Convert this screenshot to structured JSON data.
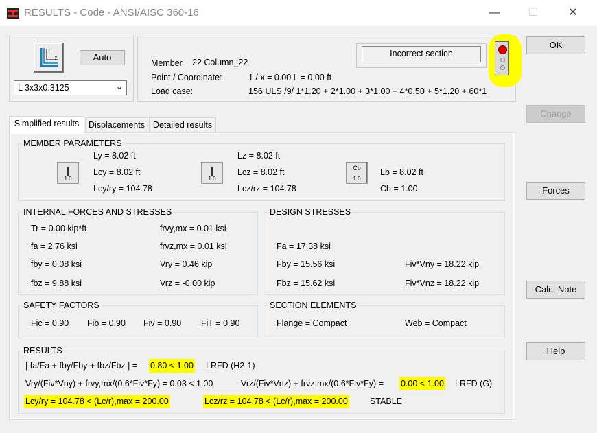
{
  "window": {
    "title": "RESULTS - Code - ANSI/AISC 360-16",
    "minimize": "—",
    "maximize": "☐",
    "close": "✕"
  },
  "section": {
    "auto_label": "Auto",
    "selected": "L 3x3x0.3125"
  },
  "info": {
    "status": "Incorrect section",
    "member_label": "Member",
    "member_value": "22  Column_22",
    "point_label": "Point / Coordinate:",
    "point_value": "1 / x = 0.00 L = 0.00 ft",
    "load_label": "Load case:",
    "load_value": "156 ULS /9/  1*1.20 + 2*1.00 + 3*1.00 + 4*0.50 + 5*1.20 + 60*1"
  },
  "buttons": {
    "ok": "OK",
    "change": "Change",
    "forces": "Forces",
    "calc_note": "Calc. Note",
    "help": "Help"
  },
  "tabs": [
    "Simplified results",
    "Displacements",
    "Detailed results"
  ],
  "member_params": {
    "title": "MEMBER PARAMETERS",
    "icon_label": "1.0",
    "cb_icon": "Cb",
    "ly": "Ly = 8.02 ft",
    "lcy": "Lcy = 8.02 ft",
    "lcy_ry": "Lcy/ry = 104.78",
    "lz": "Lz = 8.02 ft",
    "lcz": "Lcz = 8.02 ft",
    "lcz_rz": "Lcz/rz = 104.78",
    "lb": "Lb = 8.02 ft",
    "cb": "Cb = 1.00"
  },
  "internal": {
    "title": "INTERNAL FORCES AND STRESSES",
    "tr": "Tr = 0.00 kip*ft",
    "fa": "fa = 2.76 ksi",
    "fby": "fby = 0.08 ksi",
    "fbz": "fbz = 9.88 ksi",
    "frvy": "frvy,mx = 0.01 ksi",
    "frvz": "frvz,mx = 0.01 ksi",
    "vry": "Vry = 0.46 kip",
    "vrz": "Vrz = -0.00 kip"
  },
  "design": {
    "title": "DESIGN STRESSES",
    "fa": "Fa = 17.38 ksi",
    "fby": "Fby = 15.56 ksi",
    "fbz": "Fbz = 15.62 ksi",
    "fivvny": "Fiv*Vny = 18.22 kip",
    "fivvnz": "Fiv*Vnz = 18.22 kip"
  },
  "safety": {
    "title": "SAFETY FACTORS",
    "fic": "Fic = 0.90",
    "fib": "Fib = 0.90",
    "fiv": "Fiv = 0.90",
    "fit": "FiT = 0.90"
  },
  "elements": {
    "title": "SECTION ELEMENTS",
    "flange": "Flange = Compact",
    "web": "Web = Compact"
  },
  "results": {
    "title": "RESULTS",
    "r1_a": "| fa/Fa + fby/Fby + fbz/Fbz | = ",
    "r1_b": "0.80 < 1.00",
    "r1_c": "LRFD (H2-1)",
    "r2_a": "Vry/(Fiv*Vny) + frvy,mx/(0.6*Fiv*Fy) = 0.03 < 1.00",
    "r2_b": "Vrz/(Fiv*Vnz) + frvz,mx/(0.6*Fiv*Fy) = ",
    "r2_c": "0.00 < 1.00",
    "r2_d": "LRFD (G)",
    "r3_a": "Lcy/ry = 104.78 < (Lc/r),max = 200.00",
    "r3_b": "Lcz/rz = 104.78 < (Lc/r),max = 200.00",
    "r3_c": "STABLE"
  },
  "colors": {
    "highlight": "#ffff00",
    "indicator_red": "#e00000"
  }
}
